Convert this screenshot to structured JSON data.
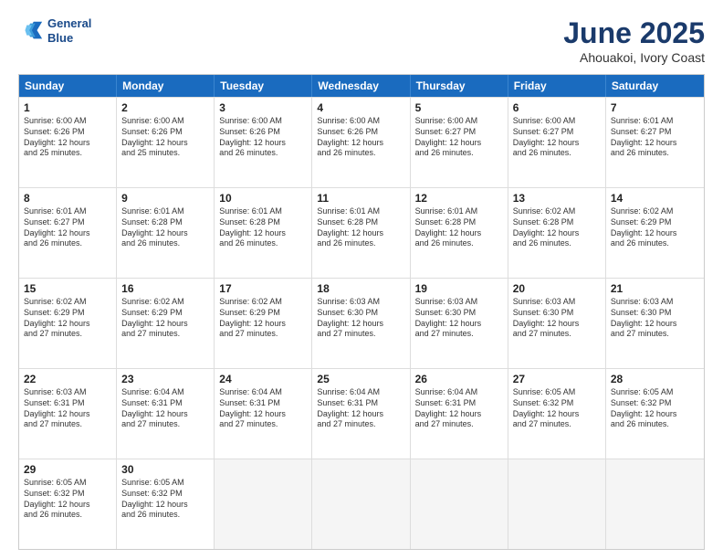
{
  "logo": {
    "line1": "General",
    "line2": "Blue"
  },
  "title": "June 2025",
  "subtitle": "Ahouakoi, Ivory Coast",
  "weekdays": [
    "Sunday",
    "Monday",
    "Tuesday",
    "Wednesday",
    "Thursday",
    "Friday",
    "Saturday"
  ],
  "weeks": [
    [
      {
        "day": "1",
        "lines": [
          "Sunrise: 6:00 AM",
          "Sunset: 6:26 PM",
          "Daylight: 12 hours",
          "and 25 minutes."
        ]
      },
      {
        "day": "2",
        "lines": [
          "Sunrise: 6:00 AM",
          "Sunset: 6:26 PM",
          "Daylight: 12 hours",
          "and 25 minutes."
        ]
      },
      {
        "day": "3",
        "lines": [
          "Sunrise: 6:00 AM",
          "Sunset: 6:26 PM",
          "Daylight: 12 hours",
          "and 26 minutes."
        ]
      },
      {
        "day": "4",
        "lines": [
          "Sunrise: 6:00 AM",
          "Sunset: 6:26 PM",
          "Daylight: 12 hours",
          "and 26 minutes."
        ]
      },
      {
        "day": "5",
        "lines": [
          "Sunrise: 6:00 AM",
          "Sunset: 6:27 PM",
          "Daylight: 12 hours",
          "and 26 minutes."
        ]
      },
      {
        "day": "6",
        "lines": [
          "Sunrise: 6:00 AM",
          "Sunset: 6:27 PM",
          "Daylight: 12 hours",
          "and 26 minutes."
        ]
      },
      {
        "day": "7",
        "lines": [
          "Sunrise: 6:01 AM",
          "Sunset: 6:27 PM",
          "Daylight: 12 hours",
          "and 26 minutes."
        ]
      }
    ],
    [
      {
        "day": "8",
        "lines": [
          "Sunrise: 6:01 AM",
          "Sunset: 6:27 PM",
          "Daylight: 12 hours",
          "and 26 minutes."
        ]
      },
      {
        "day": "9",
        "lines": [
          "Sunrise: 6:01 AM",
          "Sunset: 6:28 PM",
          "Daylight: 12 hours",
          "and 26 minutes."
        ]
      },
      {
        "day": "10",
        "lines": [
          "Sunrise: 6:01 AM",
          "Sunset: 6:28 PM",
          "Daylight: 12 hours",
          "and 26 minutes."
        ]
      },
      {
        "day": "11",
        "lines": [
          "Sunrise: 6:01 AM",
          "Sunset: 6:28 PM",
          "Daylight: 12 hours",
          "and 26 minutes."
        ]
      },
      {
        "day": "12",
        "lines": [
          "Sunrise: 6:01 AM",
          "Sunset: 6:28 PM",
          "Daylight: 12 hours",
          "and 26 minutes."
        ]
      },
      {
        "day": "13",
        "lines": [
          "Sunrise: 6:02 AM",
          "Sunset: 6:28 PM",
          "Daylight: 12 hours",
          "and 26 minutes."
        ]
      },
      {
        "day": "14",
        "lines": [
          "Sunrise: 6:02 AM",
          "Sunset: 6:29 PM",
          "Daylight: 12 hours",
          "and 26 minutes."
        ]
      }
    ],
    [
      {
        "day": "15",
        "lines": [
          "Sunrise: 6:02 AM",
          "Sunset: 6:29 PM",
          "Daylight: 12 hours",
          "and 27 minutes."
        ]
      },
      {
        "day": "16",
        "lines": [
          "Sunrise: 6:02 AM",
          "Sunset: 6:29 PM",
          "Daylight: 12 hours",
          "and 27 minutes."
        ]
      },
      {
        "day": "17",
        "lines": [
          "Sunrise: 6:02 AM",
          "Sunset: 6:29 PM",
          "Daylight: 12 hours",
          "and 27 minutes."
        ]
      },
      {
        "day": "18",
        "lines": [
          "Sunrise: 6:03 AM",
          "Sunset: 6:30 PM",
          "Daylight: 12 hours",
          "and 27 minutes."
        ]
      },
      {
        "day": "19",
        "lines": [
          "Sunrise: 6:03 AM",
          "Sunset: 6:30 PM",
          "Daylight: 12 hours",
          "and 27 minutes."
        ]
      },
      {
        "day": "20",
        "lines": [
          "Sunrise: 6:03 AM",
          "Sunset: 6:30 PM",
          "Daylight: 12 hours",
          "and 27 minutes."
        ]
      },
      {
        "day": "21",
        "lines": [
          "Sunrise: 6:03 AM",
          "Sunset: 6:30 PM",
          "Daylight: 12 hours",
          "and 27 minutes."
        ]
      }
    ],
    [
      {
        "day": "22",
        "lines": [
          "Sunrise: 6:03 AM",
          "Sunset: 6:31 PM",
          "Daylight: 12 hours",
          "and 27 minutes."
        ]
      },
      {
        "day": "23",
        "lines": [
          "Sunrise: 6:04 AM",
          "Sunset: 6:31 PM",
          "Daylight: 12 hours",
          "and 27 minutes."
        ]
      },
      {
        "day": "24",
        "lines": [
          "Sunrise: 6:04 AM",
          "Sunset: 6:31 PM",
          "Daylight: 12 hours",
          "and 27 minutes."
        ]
      },
      {
        "day": "25",
        "lines": [
          "Sunrise: 6:04 AM",
          "Sunset: 6:31 PM",
          "Daylight: 12 hours",
          "and 27 minutes."
        ]
      },
      {
        "day": "26",
        "lines": [
          "Sunrise: 6:04 AM",
          "Sunset: 6:31 PM",
          "Daylight: 12 hours",
          "and 27 minutes."
        ]
      },
      {
        "day": "27",
        "lines": [
          "Sunrise: 6:05 AM",
          "Sunset: 6:32 PM",
          "Daylight: 12 hours",
          "and 27 minutes."
        ]
      },
      {
        "day": "28",
        "lines": [
          "Sunrise: 6:05 AM",
          "Sunset: 6:32 PM",
          "Daylight: 12 hours",
          "and 26 minutes."
        ]
      }
    ],
    [
      {
        "day": "29",
        "lines": [
          "Sunrise: 6:05 AM",
          "Sunset: 6:32 PM",
          "Daylight: 12 hours",
          "and 26 minutes."
        ]
      },
      {
        "day": "30",
        "lines": [
          "Sunrise: 6:05 AM",
          "Sunset: 6:32 PM",
          "Daylight: 12 hours",
          "and 26 minutes."
        ]
      },
      {
        "day": "",
        "lines": []
      },
      {
        "day": "",
        "lines": []
      },
      {
        "day": "",
        "lines": []
      },
      {
        "day": "",
        "lines": []
      },
      {
        "day": "",
        "lines": []
      }
    ]
  ]
}
